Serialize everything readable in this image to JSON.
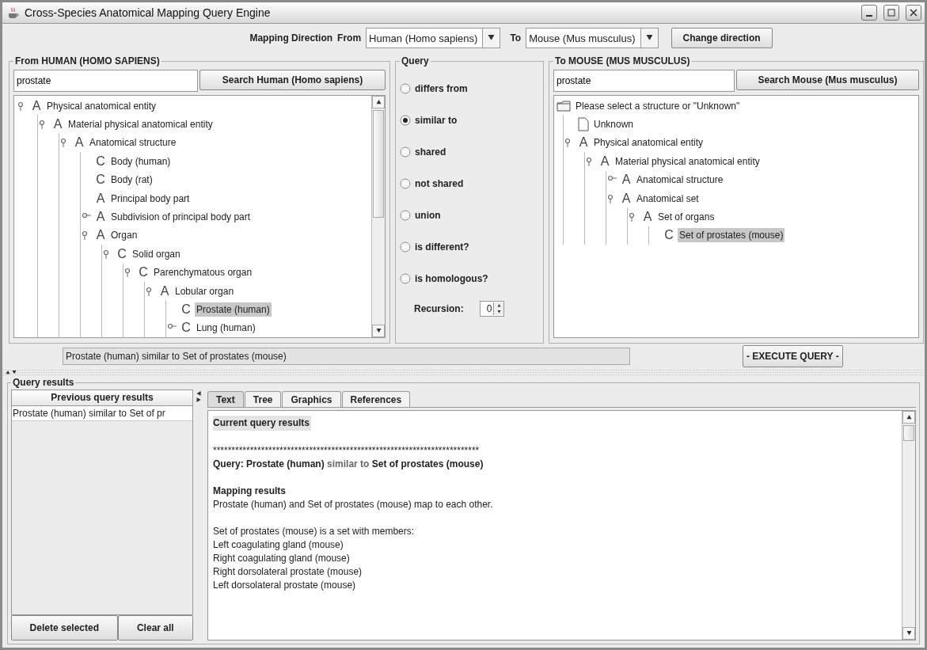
{
  "window": {
    "title": "Cross-Species Anatomical Mapping Query Engine"
  },
  "mapping": {
    "label": "Mapping Direction",
    "from_label": "From",
    "from_value": "Human (Homo sapiens)",
    "to_label": "To",
    "to_value": "Mouse (Mus musculus)",
    "change_button": "Change direction"
  },
  "source_panel": {
    "title": "From HUMAN (HOMO SAPIENS)",
    "search_value": "prostate",
    "search_button": "Search Human (Homo sapiens)",
    "tree": [
      {
        "kind": "term",
        "badge": "A",
        "label": "Physical anatomical entity",
        "expanded": true,
        "selected": false,
        "children": [
          {
            "kind": "term",
            "badge": "A",
            "label": "Material physical anatomical entity",
            "expanded": true,
            "selected": false,
            "children": [
              {
                "kind": "term",
                "badge": "A",
                "label": "Anatomical structure",
                "expanded": true,
                "selected": false,
                "children": [
                  {
                    "kind": "term",
                    "badge": "C",
                    "label": "Body (human)",
                    "selected": false
                  },
                  {
                    "kind": "term",
                    "badge": "C",
                    "label": "Body (rat)",
                    "selected": false
                  },
                  {
                    "kind": "term",
                    "badge": "A",
                    "label": "Principal body part",
                    "selected": false
                  },
                  {
                    "kind": "term",
                    "badge": "A",
                    "label": "Subdivision of principal body part",
                    "expanded": false,
                    "selected": false
                  },
                  {
                    "kind": "term",
                    "badge": "A",
                    "label": "Organ",
                    "expanded": true,
                    "selected": false,
                    "children": [
                      {
                        "kind": "term",
                        "badge": "C",
                        "label": "Solid organ",
                        "expanded": true,
                        "selected": false,
                        "children": [
                          {
                            "kind": "term",
                            "badge": "C",
                            "label": "Parenchymatous organ",
                            "expanded": true,
                            "selected": false,
                            "children": [
                              {
                                "kind": "term",
                                "badge": "A",
                                "label": "Lobular organ",
                                "expanded": true,
                                "selected": false,
                                "children": [
                                  {
                                    "kind": "term",
                                    "badge": "C",
                                    "label": "Prostate (human)",
                                    "selected": true
                                  },
                                  {
                                    "kind": "term",
                                    "badge": "C",
                                    "label": "Lung (human)",
                                    "expanded": false,
                                    "selected": false
                                  }
                                ]
                              }
                            ]
                          }
                        ]
                      }
                    ]
                  }
                ]
              }
            ]
          }
        ]
      }
    ]
  },
  "query_panel": {
    "title": "Query",
    "options": [
      {
        "label": "differs from",
        "selected": false
      },
      {
        "label": "similar to",
        "selected": true
      },
      {
        "label": "shared",
        "selected": false
      },
      {
        "label": "not shared",
        "selected": false
      },
      {
        "label": "union",
        "selected": false
      },
      {
        "label": "is different?",
        "selected": false
      },
      {
        "label": "is homologous?",
        "selected": false
      }
    ],
    "recursion_label": "Recursion:",
    "recursion_value": "0"
  },
  "target_panel": {
    "title": "To MOUSE (MUS MUSCULUS)",
    "search_value": "prostate",
    "search_button": "Search Mouse (Mus musculus)",
    "tree": [
      {
        "kind": "folder",
        "label": "Please select a structure or \"Unknown\"",
        "selected": false,
        "children": [
          {
            "kind": "document",
            "label": "Unknown",
            "selected": false
          },
          {
            "kind": "term",
            "badge": "A",
            "label": "Physical anatomical entity",
            "expanded": true,
            "selected": false,
            "children": [
              {
                "kind": "term",
                "badge": "A",
                "label": "Material physical anatomical entity",
                "expanded": true,
                "selected": false,
                "children": [
                  {
                    "kind": "term",
                    "badge": "A",
                    "label": "Anatomical structure",
                    "expanded": false,
                    "selected": false
                  },
                  {
                    "kind": "term",
                    "badge": "A",
                    "label": "Anatomical set",
                    "expanded": true,
                    "selected": false,
                    "children": [
                      {
                        "kind": "term",
                        "badge": "A",
                        "label": "Set of organs",
                        "expanded": true,
                        "selected": false,
                        "children": [
                          {
                            "kind": "term",
                            "badge": "C",
                            "label": "Set of prostates (mouse)",
                            "selected": true
                          }
                        ]
                      }
                    ]
                  }
                ]
              }
            ]
          }
        ]
      }
    ]
  },
  "query_summary": "Prostate (human) similar to Set of prostates (mouse)",
  "execute_button": "- EXECUTE QUERY -",
  "results": {
    "title": "Query results",
    "history_header": "Previous query results",
    "history": [
      {
        "text": "Prostate (human) similar to Set of pr"
      }
    ],
    "delete_button": "Delete selected",
    "clear_button": "Clear all",
    "tabs": [
      {
        "label": "Text",
        "selected": true
      },
      {
        "label": "Tree",
        "selected": false
      },
      {
        "label": "Graphics",
        "selected": false
      },
      {
        "label": "References",
        "selected": false
      }
    ],
    "paragraphs": [
      [
        {
          "kind": "heading",
          "text": "Current query results"
        }
      ],
      [
        {
          "kind": "rule",
          "text": "************************************************************************"
        },
        {
          "kind": "query",
          "subject": "Query: Prostate (human)",
          "relation": "similar to",
          "object": "Set of prostates (mouse)"
        }
      ],
      [
        {
          "kind": "subheading",
          "text": "Mapping results"
        },
        {
          "kind": "text",
          "text": "Prostate (human) and Set of prostates (mouse) map to each other."
        }
      ],
      [
        {
          "kind": "text",
          "text": "Set of prostates (mouse) is a set with members:"
        },
        {
          "kind": "text",
          "text": "Left coagulating gland (mouse)"
        },
        {
          "kind": "text",
          "text": "Right coagulating gland (mouse)"
        },
        {
          "kind": "text",
          "text": "Right dorsolateral prostate (mouse)"
        },
        {
          "kind": "text",
          "text": "Left dorsolateral prostate (mouse)"
        }
      ]
    ]
  }
}
